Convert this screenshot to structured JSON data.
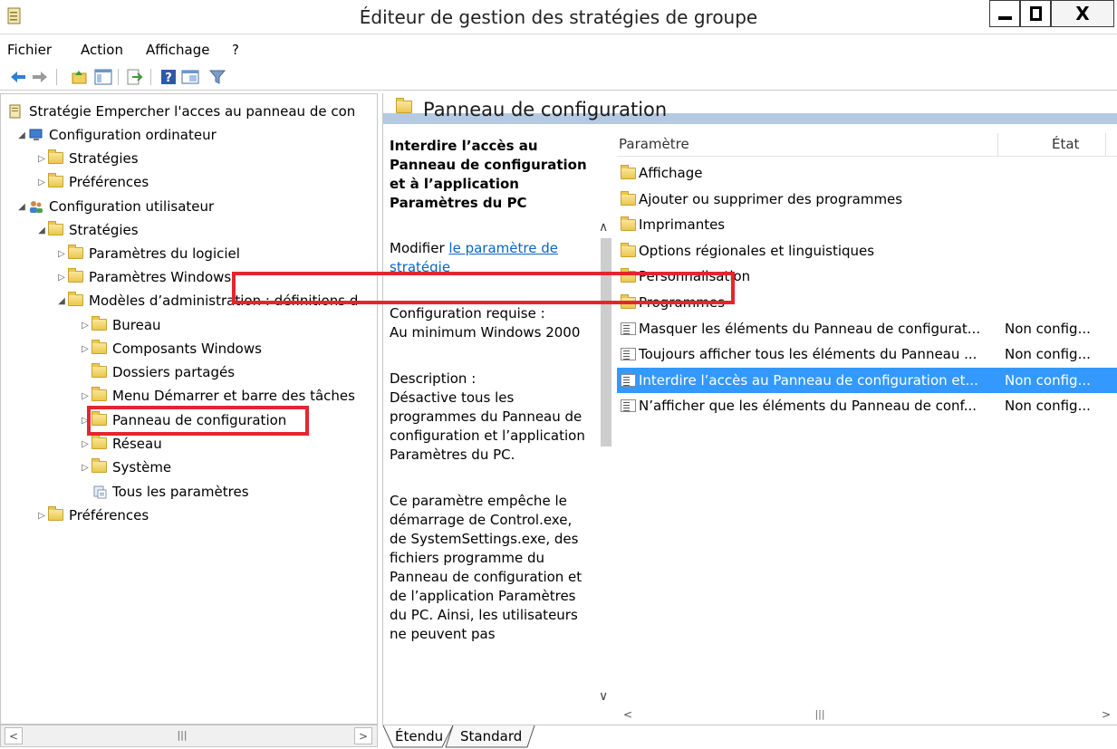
{
  "window": {
    "title": "Éditeur de gestion des stratégies de groupe",
    "close_label": "X"
  },
  "menu": {
    "items": [
      "Fichier",
      "Action",
      "Affichage",
      "?"
    ]
  },
  "toolbar": {
    "icons": [
      "back-icon",
      "forward-icon",
      "up-folder-icon",
      "show-tree-icon",
      "export-icon",
      "help-icon",
      "properties-icon",
      "filter-icon"
    ]
  },
  "tree": {
    "root": "Stratégie Empercher l'acces au panneau de con",
    "computer_config": "Configuration ordinateur",
    "cc_strategies": "Stratégies",
    "cc_preferences": "Préférences",
    "user_config": "Configuration utilisateur",
    "uc_strategies": "Stratégies",
    "software_settings": "Paramètres du logiciel",
    "windows_settings": "Paramètres Windows",
    "admin_templates": "Modèles d’administration : définitions d",
    "desktop": "Bureau",
    "windows_components": "Composants Windows",
    "shared_folders": "Dossiers partagés",
    "start_menu": "Menu Démarrer et barre des tâches",
    "control_panel": "Panneau de configuration",
    "network": "Réseau",
    "system": "Système",
    "all_settings": "Tous les paramètres",
    "uc_preferences": "Préférences"
  },
  "right": {
    "header_title": "Panneau de configuration",
    "description": {
      "title": "Interdire l’accès au Panneau de configuration et à l’application Paramètres du PC",
      "edit_prefix": "Modifier ",
      "edit_link": "le paramètre de stratégie",
      "requirements_label": "Configuration requise :",
      "requirements_value": "Au minimum Windows 2000",
      "description_label": "Description :",
      "description_text": "Désactive tous les programmes du Panneau de configuration et l’application Paramètres du PC.",
      "details_text": "Ce paramètre empêche le démarrage de Control.exe, de SystemSettings.exe, des fichiers programme du Panneau de configuration et de l’application Paramètres du PC. Ainsi, les utilisateurs ne peuvent pas"
    },
    "list": {
      "columns": [
        "Paramètre",
        "État"
      ],
      "rows": [
        {
          "name": "Affichage",
          "state": "",
          "kind": "folder"
        },
        {
          "name": "Ajouter ou supprimer des programmes",
          "state": "",
          "kind": "folder"
        },
        {
          "name": "Imprimantes",
          "state": "",
          "kind": "folder"
        },
        {
          "name": "Options régionales et linguistiques",
          "state": "",
          "kind": "folder"
        },
        {
          "name": "Personnalisation",
          "state": "",
          "kind": "folder"
        },
        {
          "name": "Programmes",
          "state": "",
          "kind": "folder"
        },
        {
          "name": "Masquer les éléments du Panneau de configurat...",
          "state": "Non config...",
          "kind": "setting"
        },
        {
          "name": "Toujours afficher tous les éléments du Panneau ...",
          "state": "Non config...",
          "kind": "setting"
        },
        {
          "name": "Interdire l’accès au Panneau de configuration et...",
          "state": "Non config...",
          "kind": "setting"
        },
        {
          "name": "N’afficher que les éléments du Panneau de conf...",
          "state": "Non config...",
          "kind": "setting"
        }
      ]
    }
  },
  "tabs": {
    "extended": "Étendu",
    "standard": "Standard"
  },
  "colors": {
    "selection": "#3399ff",
    "highlight_box": "#e3262d",
    "header_band": "#b6c9e2",
    "link": "#0b65c2"
  }
}
